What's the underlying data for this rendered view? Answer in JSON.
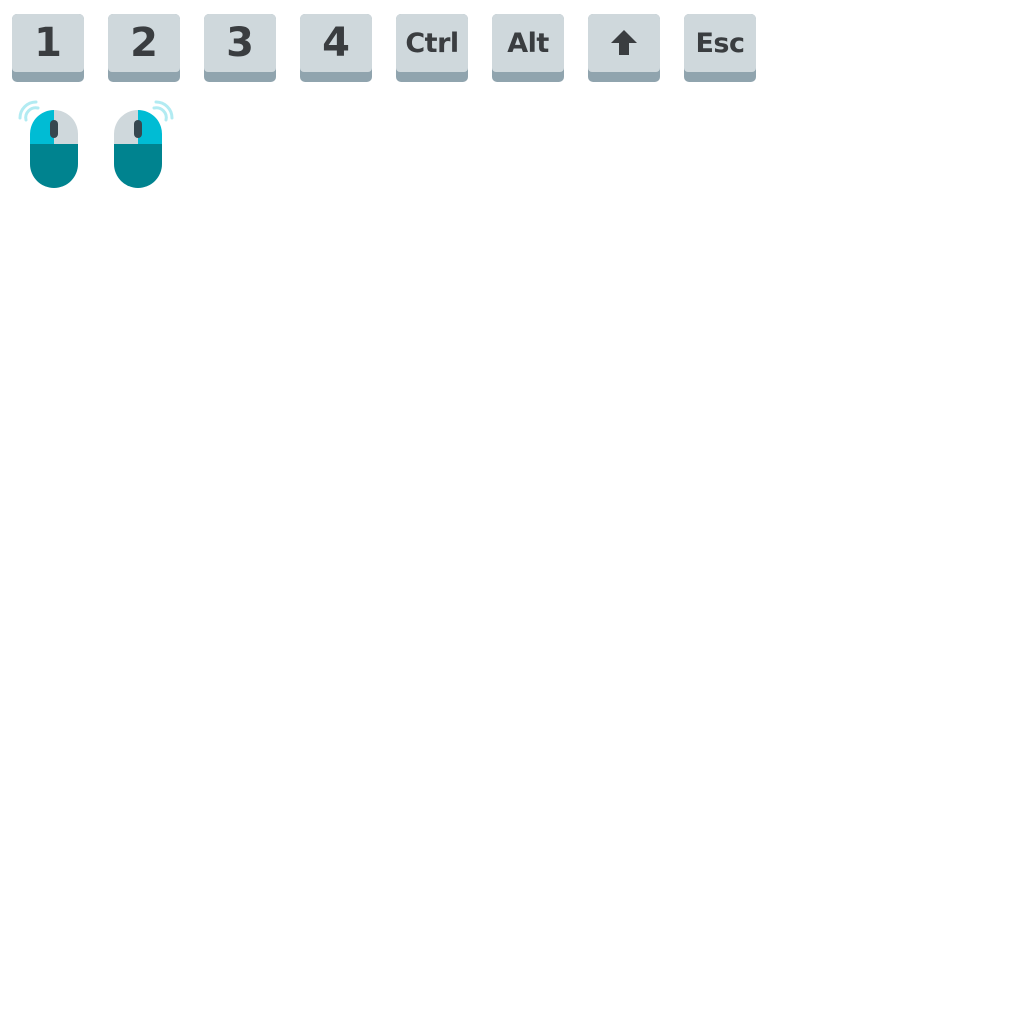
{
  "keys": [
    {
      "label": "1",
      "icon": null
    },
    {
      "label": "2",
      "icon": null
    },
    {
      "label": "3",
      "icon": null
    },
    {
      "label": "4",
      "icon": null
    },
    {
      "label": "Ctrl",
      "icon": null
    },
    {
      "label": "Alt",
      "icon": null
    },
    {
      "label": "",
      "icon": "shift-arrow-up-icon"
    },
    {
      "label": "Esc",
      "icon": null
    }
  ],
  "mice": [
    {
      "icon": "mouse-left-click-icon"
    },
    {
      "icon": "mouse-right-click-icon"
    }
  ],
  "colors": {
    "key_top": "#cfd8dc",
    "key_base": "#90a4ae",
    "key_text": "#3a3d40",
    "mouse_active": "#00bcd4",
    "mouse_body": "#00838f",
    "mouse_idle": "#cfd8dc",
    "wave": "#b2ebf2"
  }
}
